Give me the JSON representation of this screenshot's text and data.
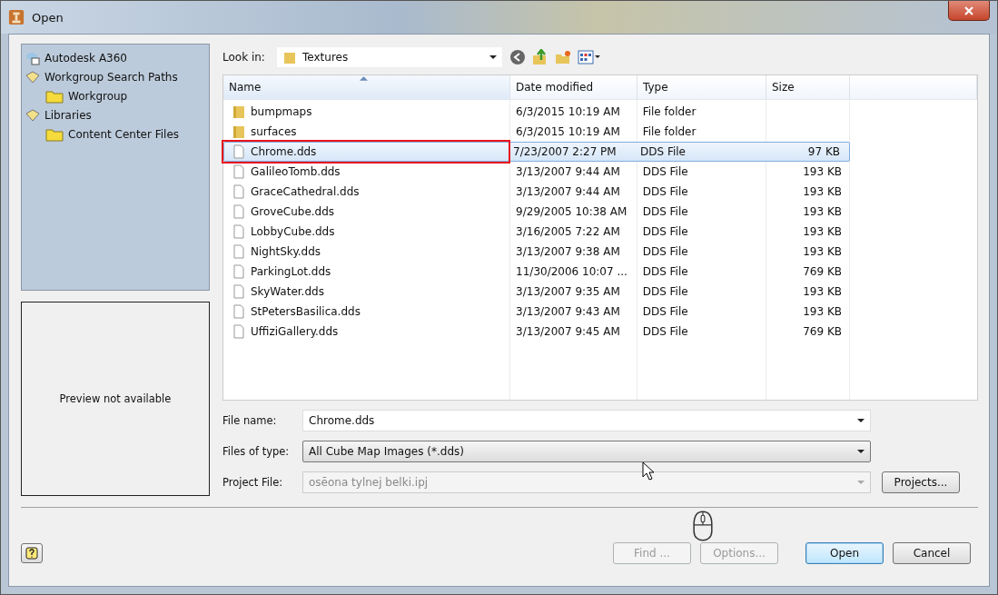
{
  "window": {
    "title": "Open"
  },
  "places": [
    {
      "label": "Autodesk A360",
      "kind": "cloud"
    },
    {
      "label": "Workgroup Search Paths",
      "kind": "library",
      "children": [
        {
          "label": "Workgroup",
          "kind": "folder"
        }
      ]
    },
    {
      "label": "Libraries",
      "kind": "library",
      "children": [
        {
          "label": "Content Center Files",
          "kind": "folder"
        }
      ]
    }
  ],
  "preview": {
    "text": "Preview not available"
  },
  "look_in": {
    "label": "Look in:",
    "value": "Textures"
  },
  "columns": [
    {
      "label": "Name",
      "sorted": true
    },
    {
      "label": "Date modified",
      "sorted": false
    },
    {
      "label": "Type",
      "sorted": false
    },
    {
      "label": "Size",
      "sorted": false
    }
  ],
  "files": [
    {
      "name": "bumpmaps",
      "date": "6/3/2015 10:19 AM",
      "type": "File folder",
      "kind": "folder",
      "selected": false,
      "highlighted": false
    },
    {
      "name": "surfaces",
      "date": "6/3/2015 10:19 AM",
      "type": "File folder",
      "kind": "folder",
      "selected": false,
      "highlighted": false
    },
    {
      "name": "Chrome.dds",
      "date": "7/23/2007 2:27 PM",
      "type": "DDS File",
      "size": "97 KB",
      "kind": "file",
      "selected": true,
      "highlighted": true
    },
    {
      "name": "GalileoTomb.dds",
      "date": "3/13/2007 9:44 AM",
      "type": "DDS File",
      "size": "193 KB",
      "kind": "file",
      "selected": false,
      "highlighted": false
    },
    {
      "name": "GraceCathedral.dds",
      "date": "3/13/2007 9:44 AM",
      "type": "DDS File",
      "size": "193 KB",
      "kind": "file",
      "selected": false,
      "highlighted": false
    },
    {
      "name": "GroveCube.dds",
      "date": "9/29/2005 10:38 AM",
      "type": "DDS File",
      "size": "193 KB",
      "kind": "file",
      "selected": false,
      "highlighted": false
    },
    {
      "name": "LobbyCube.dds",
      "date": "3/16/2005 7:22 AM",
      "type": "DDS File",
      "size": "193 KB",
      "kind": "file",
      "selected": false,
      "highlighted": false
    },
    {
      "name": "NightSky.dds",
      "date": "3/13/2007 9:38 AM",
      "type": "DDS File",
      "size": "193 KB",
      "kind": "file",
      "selected": false,
      "highlighted": false
    },
    {
      "name": "ParkingLot.dds",
      "date": "11/30/2006 10:07 ...",
      "type": "DDS File",
      "size": "769 KB",
      "kind": "file",
      "selected": false,
      "highlighted": false
    },
    {
      "name": "SkyWater.dds",
      "date": "3/13/2007 9:35 AM",
      "type": "DDS File",
      "size": "193 KB",
      "kind": "file",
      "selected": false,
      "highlighted": false
    },
    {
      "name": "StPetersBasilica.dds",
      "date": "3/13/2007 9:43 AM",
      "type": "DDS File",
      "size": "193 KB",
      "kind": "file",
      "selected": false,
      "highlighted": false
    },
    {
      "name": "UffiziGallery.dds",
      "date": "3/13/2007 9:45 AM",
      "type": "DDS File",
      "size": "769 KB",
      "kind": "file",
      "selected": false,
      "highlighted": false
    }
  ],
  "fields": [
    {
      "label": "File name:",
      "value": "Chrome.dds",
      "disabled": false,
      "kind": "combo"
    },
    {
      "label": "Files of type:",
      "value": "All Cube Map Images (*.dds)",
      "disabled": false,
      "kind": "dropdown"
    },
    {
      "label": "Project File:",
      "value": "osēona tylnej belki.ipj",
      "disabled": true,
      "kind": "combo"
    }
  ],
  "projects_button": "Projects...",
  "buttons": [
    {
      "label": "Find ...",
      "disabled": true,
      "default": false
    },
    {
      "label": "Options...",
      "disabled": true,
      "default": false
    },
    {
      "label": "Open",
      "disabled": false,
      "default": true
    },
    {
      "label": "Cancel",
      "disabled": false,
      "default": false
    }
  ]
}
